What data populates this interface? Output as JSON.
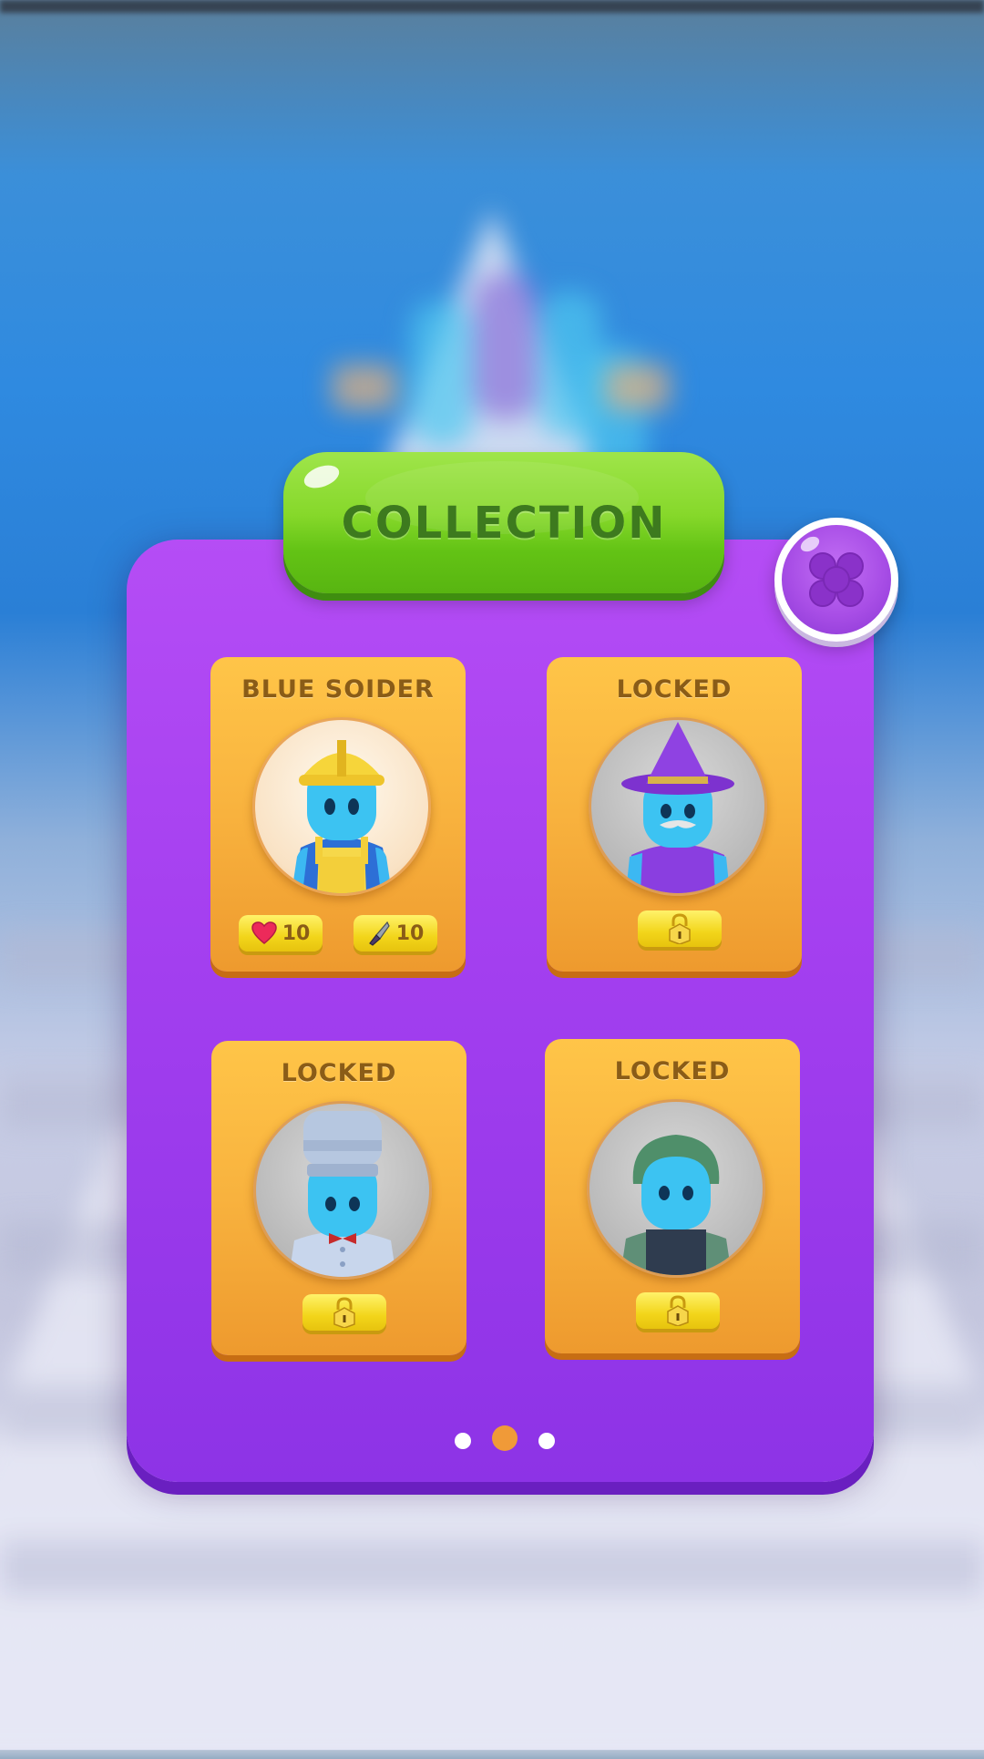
{
  "screen": {
    "title": "COLLECTION",
    "close_icon": "close-x-icon"
  },
  "cards": [
    {
      "title": "BLUE SOIDER",
      "status": "unlocked",
      "character": "builder-hardhat",
      "stats": {
        "health": "10",
        "attack": "10"
      }
    },
    {
      "title": "LOCKED",
      "status": "locked",
      "character": "wizard"
    },
    {
      "title": "LOCKED",
      "status": "locked",
      "character": "chef"
    },
    {
      "title": "LOCKED",
      "status": "locked",
      "character": "soldier-helmet"
    }
  ],
  "pagination": {
    "pages": 3,
    "current": 2
  },
  "colors": {
    "panel": "#a540f0",
    "title_button": "#86d82a",
    "card": "#f8b23e",
    "pill": "#f2d51a",
    "active_dot": "#f09a38"
  }
}
